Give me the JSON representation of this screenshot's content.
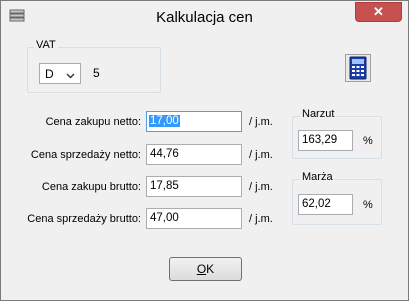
{
  "window": {
    "title": "Kalkulacja cen",
    "close_label": "✕"
  },
  "vat": {
    "legend": "VAT",
    "selected": "D",
    "rate": "5"
  },
  "fields": {
    "net_purchase_label": "Cena zakupu netto:",
    "net_purchase_value": "17,00",
    "net_sale_label": "Cena sprzedaży netto:",
    "net_sale_value": "44,76",
    "gross_purchase_label": "Cena zakupu brutto:",
    "gross_purchase_value": "17,85",
    "gross_sale_label": "Cena sprzedaży brutto:",
    "gross_sale_value": "47,00",
    "unit_label": "/ j.m."
  },
  "markup": {
    "legend": "Narzut",
    "value": "163,29",
    "unit": "%"
  },
  "margin": {
    "legend": "Marża",
    "value": "62,02",
    "unit": "%"
  },
  "ok_button": {
    "label_first": "O",
    "label_rest": "K"
  },
  "icons": {
    "app": "database-icon",
    "calculator": "calculator-icon"
  }
}
